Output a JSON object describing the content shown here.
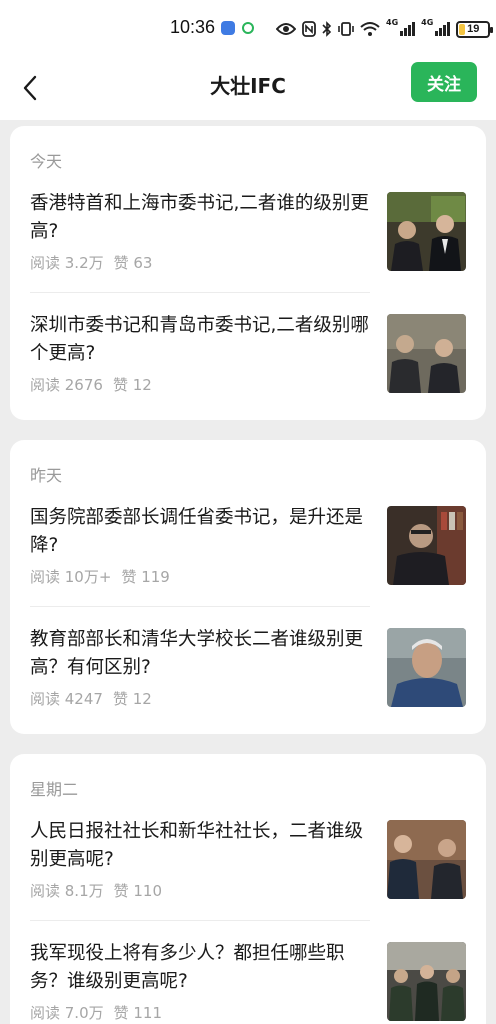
{
  "status_bar": {
    "time": "10:36",
    "network_1": "4G",
    "network_2": "4G",
    "battery": "19",
    "battery_level": 0.19
  },
  "nav": {
    "title": "大壮IFC",
    "follow_label": "关注"
  },
  "sections": [
    {
      "date": "今天",
      "articles": [
        {
          "title": "香港特首和上海市委书记,二者谁的级别更高?",
          "reads": "阅读 3.2万",
          "likes": "赞 63",
          "thumb_icon": "photo-two-officials-office"
        },
        {
          "title": "深圳市委书记和青岛市委书记,二者级别哪个更高?",
          "reads": "阅读 2676",
          "likes": "赞 12",
          "thumb_icon": "photo-two-officials-meeting"
        }
      ]
    },
    {
      "date": "昨天",
      "articles": [
        {
          "title": "国务院部委部长调任省委书记，是升还是降?",
          "reads": "阅读 10万+",
          "likes": "赞 119",
          "thumb_icon": "photo-official-bookshelf"
        },
        {
          "title": "教育部部长和清华大学校长二者谁级别更高？有何区别?",
          "reads": "阅读 4247",
          "likes": "赞 12",
          "thumb_icon": "photo-elderly-man"
        }
      ]
    },
    {
      "date": "星期二",
      "articles": [
        {
          "title": "人民日报社社长和新华社社长，二者谁级别更高呢?",
          "reads": "阅读 8.1万",
          "likes": "赞 110",
          "thumb_icon": "photo-two-men-suits"
        },
        {
          "title": "我军现役上将有多少人？都担任哪些职务？谁级别更高呢?",
          "reads": "阅读 7.0万",
          "likes": "赞 111",
          "thumb_icon": "photo-generals-table"
        }
      ]
    }
  ],
  "colors": {
    "accent": "#2ab55a",
    "background": "#ededed",
    "card": "#ffffff",
    "meta_text": "#a6a6a6"
  }
}
